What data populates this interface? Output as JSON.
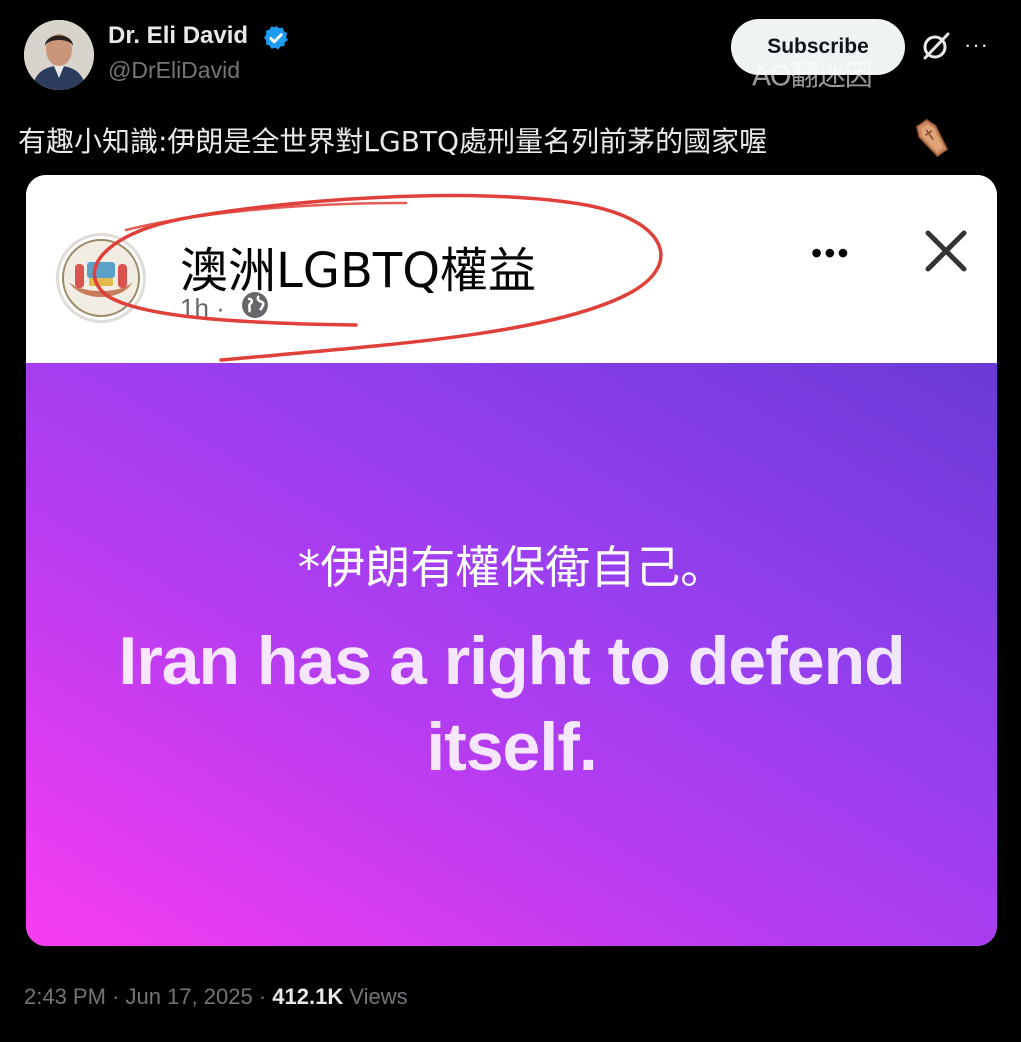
{
  "tweet": {
    "author_name": "Dr. Eli David",
    "handle": "@DrEliDavid",
    "subscribe_label": "Subscribe",
    "watermark": "AO翻迷因",
    "text": "有趣小知識:伊朗是全世界對LGBTQ處刑量名列前茅的國家喔",
    "timestamp": "2:43 PM · Jun 17, 2025",
    "separator": " · ",
    "views_count": "412.1K",
    "views_label": " Views"
  },
  "embedded_post": {
    "page_name": "澳洲LGBTQ權益",
    "time": "1h ·",
    "caption_cn": "*伊朗有權保衛自己。",
    "quote_en": "Iran has a right to defend itself."
  },
  "colors": {
    "background": "#000000",
    "verified_blue": "#1d9bf0",
    "gradient_start": "#f83cf1",
    "gradient_end": "#6a3ad8",
    "annotation_red": "#e0403a"
  },
  "icons": {
    "verified": "verified-badge-icon",
    "grok": "grok-icon",
    "more": "more-horizontal-icon",
    "coffin": "coffin-emoji-icon",
    "globe": "globe-icon",
    "close": "close-icon"
  }
}
